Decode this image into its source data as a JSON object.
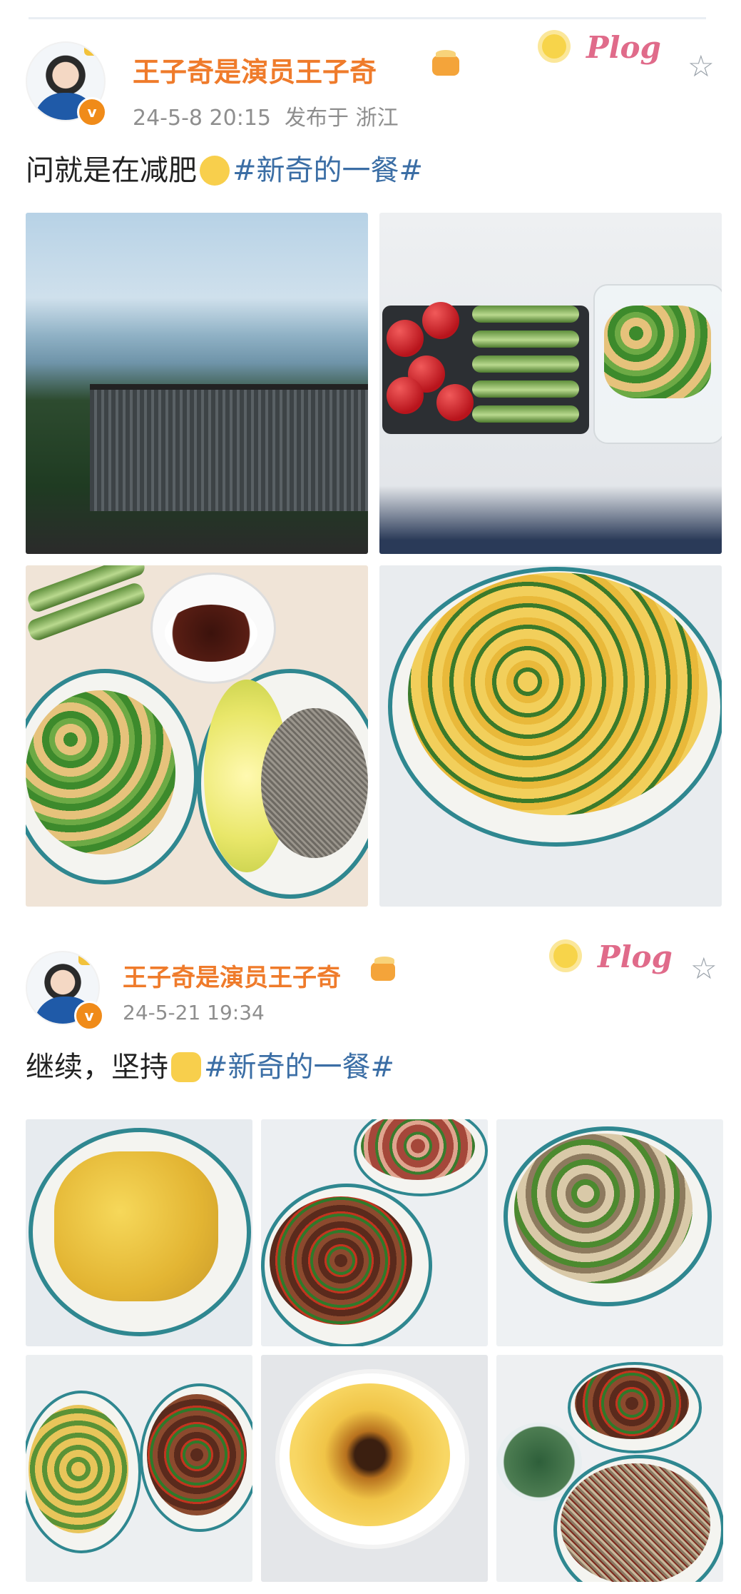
{
  "posts": [
    {
      "author": "王子奇是演员王子奇",
      "meta": "24-5-8 20:15  发布于 浙江",
      "text": "问就是在减肥",
      "hashtag": "#新奇的一餐#",
      "badge": "Plog",
      "photos": [
        "rooftop-view",
        "tomatoes-cucumbers-shrimp-salad",
        "snow-peas-noodles-lettuce",
        "scrambled-eggs-cucumber"
      ]
    },
    {
      "author": "王子奇是演员王子奇",
      "meta": "24-5-21 19:34",
      "text": "继续，坚持",
      "hashtag": "#新奇的一餐#",
      "badge": "Plog",
      "photos": [
        "scrambled-eggs",
        "meat-platter-and-beef-peppers",
        "mushroom-cucumber-stirfry",
        "cucumber-egg-and-beef",
        "steamed-egg-custard",
        "greens-soup-and-noodles"
      ]
    }
  ],
  "icons": {
    "verified": "v-badge-icon",
    "crown": "crown-icon",
    "star": "star-icon"
  },
  "colors": {
    "name": "#ef7b2b",
    "hashtag": "#3b6ea5",
    "verified": "#f08b19",
    "meta": "#8e8e8e"
  }
}
